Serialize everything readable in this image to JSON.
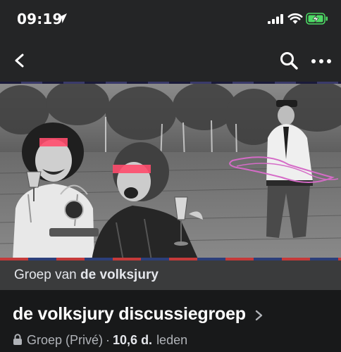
{
  "status_bar": {
    "time": "09:19",
    "icons": [
      "location-arrow-icon",
      "cellular-signal-icon",
      "wifi-icon",
      "battery-charging-icon"
    ],
    "battery_color": "#4cd964"
  },
  "nav_bar": {
    "icons": [
      "back-chevron-icon",
      "search-icon",
      "more-options-icon"
    ]
  },
  "cover_photo": {
    "overlay_colors": {
      "eye_bars": "#ff4d6d",
      "scribble": "#d56bc7"
    }
  },
  "group_of": {
    "prefix": "Groep van",
    "owner": "de volksjury"
  },
  "group": {
    "title": "de volksjury discussiegroep",
    "privacy": "Groep (Privé)",
    "separator": "·",
    "member_count": "10,6 d.",
    "member_label": "leden"
  },
  "colors": {
    "background": "#18191a",
    "header": "#242526",
    "banner": "#3a3b3c",
    "text_primary": "#ffffff",
    "text_secondary": "#b0b3b8"
  }
}
